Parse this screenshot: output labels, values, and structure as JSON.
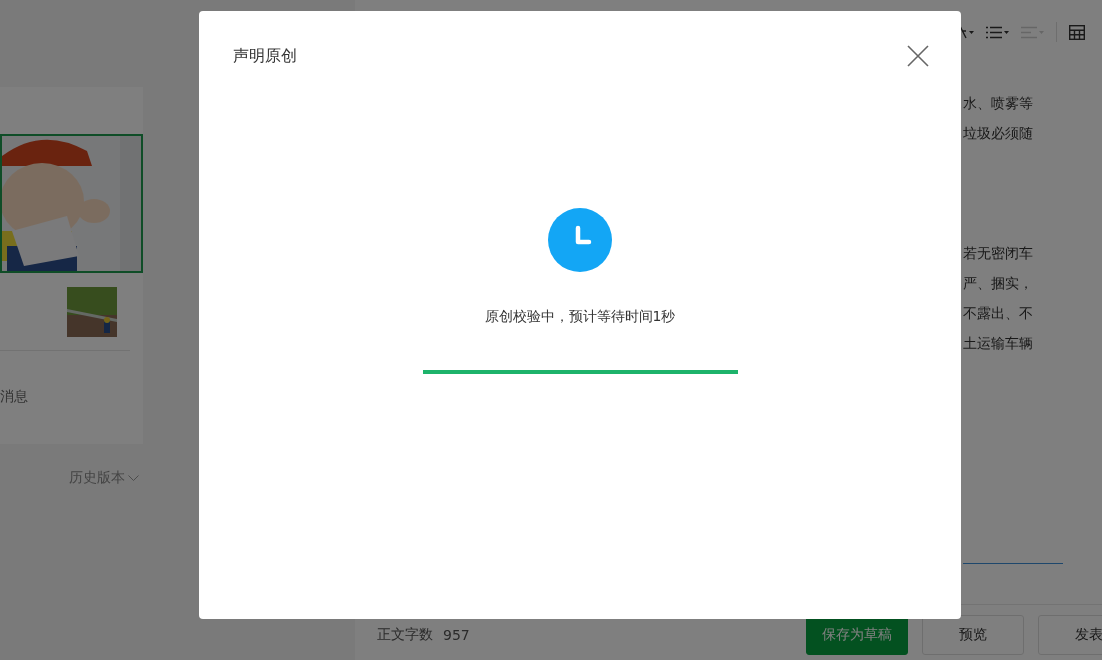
{
  "editor": {
    "toolbar": [
      {
        "kind": "font",
        "disabled": false
      },
      {
        "kind": "list",
        "disabled": false
      },
      {
        "kind": "align",
        "disabled": true
      },
      {
        "kind": "table",
        "disabled": false
      }
    ],
    "paragraphs": [
      [
        "水、喷雾等",
        "垃圾必须随"
      ],
      [
        "若无密闭车",
        "严、捆实，",
        "不露出、不",
        "土运输车辆"
      ]
    ]
  },
  "sidebar": {
    "item_text": "消息",
    "history_link": "历史版本"
  },
  "footer": {
    "word_count_label": "正文字数",
    "word_count": "957",
    "buttons": [
      {
        "label": "保存为草稿",
        "kind": "primary"
      },
      {
        "label": "预览",
        "kind": "default"
      },
      {
        "label": "发表",
        "kind": "default"
      }
    ]
  },
  "dialog": {
    "title": "声明原创",
    "message": "原创校验中，预计等待时间1秒",
    "progress": {
      "level": 1
    }
  }
}
